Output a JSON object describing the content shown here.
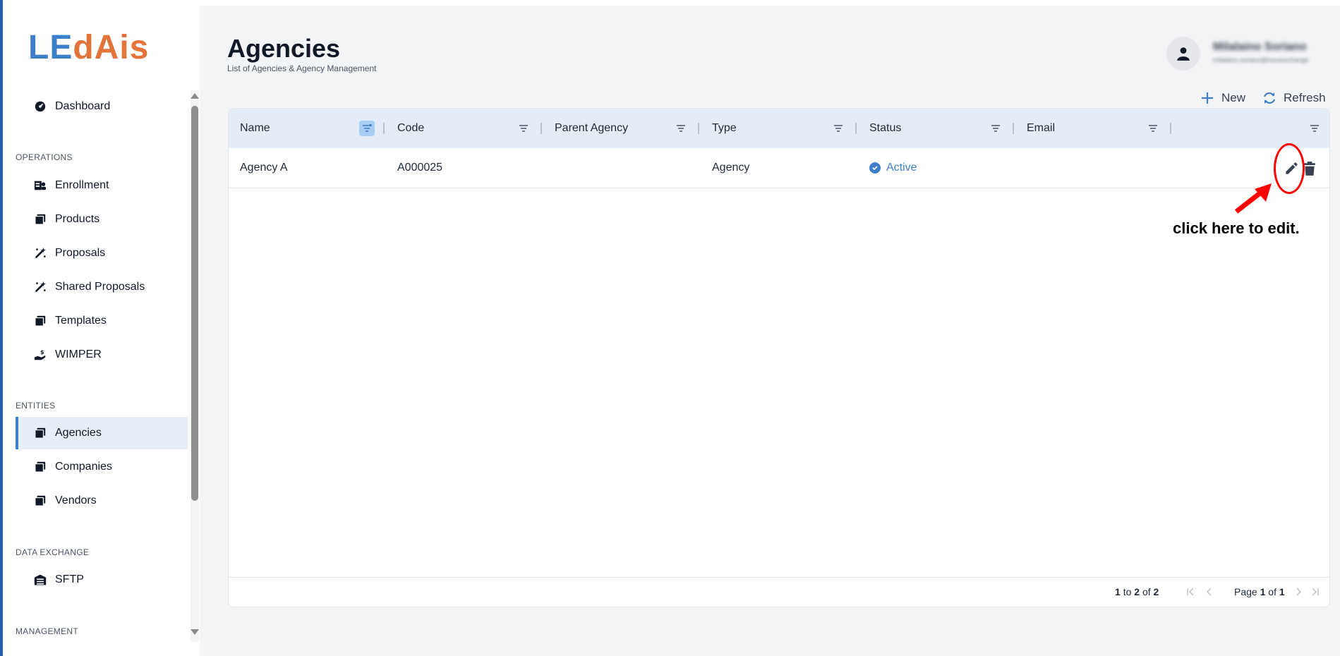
{
  "app": {
    "logo_part1": "LE",
    "logo_part2": "dAis"
  },
  "sidebar": {
    "dashboard": "Dashboard",
    "sections": {
      "operations": "OPERATIONS",
      "entities": "ENTITIES",
      "data_exchange": "DATA EXCHANGE",
      "management": "MANAGEMENT"
    },
    "items": {
      "enrollment": "Enrollment",
      "products": "Products",
      "proposals": "Proposals",
      "shared_proposals": "Shared Proposals",
      "templates": "Templates",
      "wimper": "WIMPER",
      "agencies": "Agencies",
      "companies": "Companies",
      "vendors": "Vendors",
      "sftp": "SFTP"
    }
  },
  "header": {
    "title": "Agencies",
    "subtitle": "List of Agencies & Agency Management",
    "user_name": "Milalaino Soriano",
    "user_email": "milalaino.soriano@insurexchange"
  },
  "toolbar": {
    "new_label": "New",
    "refresh_label": "Refresh"
  },
  "grid": {
    "columns": [
      "Name",
      "Code",
      "Parent Agency",
      "Type",
      "Status",
      "Email"
    ],
    "rows": [
      {
        "name": "Agency A",
        "code": "A000025",
        "parent_agency": "",
        "type": "Agency",
        "status": "Active",
        "email": ""
      }
    ],
    "footer": {
      "range_from": "1",
      "range_to_word": "to",
      "range_to": "2",
      "range_of_word": "of",
      "range_total": "2",
      "page_word": "Page",
      "page_current": "1",
      "page_of_word": "of",
      "page_total": "1"
    }
  },
  "annotation": {
    "text": "click here to edit."
  },
  "colors": {
    "accent": "#3d7fc9",
    "logo_orange": "#e2743a",
    "annotation_red": "#ff0000"
  },
  "icons": [
    "dashboard-icon",
    "enrollment-icon",
    "products-icon",
    "proposals-icon",
    "shared-proposals-icon",
    "templates-icon",
    "wimper-icon",
    "agencies-icon",
    "companies-icon",
    "vendors-icon",
    "sftp-icon",
    "user-icon",
    "plus-icon",
    "refresh-icon",
    "filter-icon",
    "check-circle-icon",
    "pencil-icon",
    "trash-icon",
    "first-page-icon",
    "prev-page-icon",
    "next-page-icon",
    "last-page-icon"
  ]
}
